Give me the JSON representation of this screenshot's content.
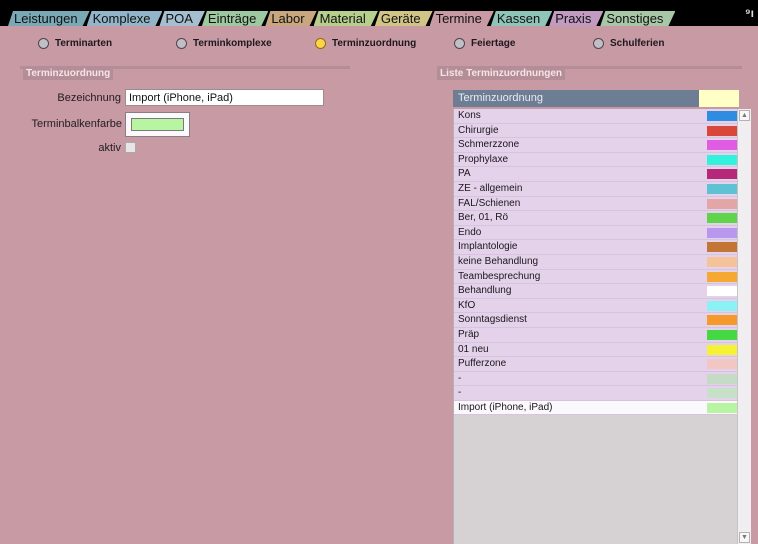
{
  "tabs": [
    {
      "label": "Leistungen",
      "color": "#79a9b5"
    },
    {
      "label": "Komplexe",
      "color": "#93b5c9"
    },
    {
      "label": "POA",
      "color": "#a6bfd0"
    },
    {
      "label": "Einträge",
      "color": "#9ec89f"
    },
    {
      "label": "Labor",
      "color": "#c9a77e"
    },
    {
      "label": "Material",
      "color": "#b7cf8c"
    },
    {
      "label": "Geräte",
      "color": "#d0c586"
    },
    {
      "label": "Termine",
      "color": "#c79aa4"
    },
    {
      "label": "Kassen",
      "color": "#8fc4b8"
    },
    {
      "label": "Praxis",
      "color": "#c29bc2"
    },
    {
      "label": "Sonstiges",
      "color": "#a8c7a6"
    }
  ],
  "radios": [
    {
      "label": "Terminarten",
      "active": false
    },
    {
      "label": "Terminkomplexe",
      "active": false
    },
    {
      "label": "Terminzuordnung",
      "active": true
    },
    {
      "label": "Feiertage",
      "active": false
    },
    {
      "label": "Schulferien",
      "active": false
    }
  ],
  "form": {
    "section_title": "Terminzuordnung",
    "bezeichnung_label": "Bezeichnung",
    "bezeichnung_value": "Import (iPhone, iPad)",
    "farbe_label": "Terminbalkenfarbe",
    "farbe_color": "#b7f5a3",
    "aktiv_label": "aktiv"
  },
  "list": {
    "section_title": "Liste Terminzuordnungen",
    "column_header": "Terminzuordnung",
    "header_swatch_color": "#ffffc6",
    "rows": [
      {
        "label": "Kons",
        "color": "#2e8de0"
      },
      {
        "label": "Chirurgie",
        "color": "#d9473a"
      },
      {
        "label": "Schmerzzone",
        "color": "#e05ce3"
      },
      {
        "label": "Prophylaxe",
        "color": "#33f2dd"
      },
      {
        "label": "PA",
        "color": "#b5287a"
      },
      {
        "label": "ZE - allgemein",
        "color": "#5ec1d4"
      },
      {
        "label": "FAL/Schienen",
        "color": "#e3a6a6"
      },
      {
        "label": "Ber, 01, Rö",
        "color": "#5fd44a"
      },
      {
        "label": "Endo",
        "color": "#b898ee"
      },
      {
        "label": "Implantologie",
        "color": "#c27534"
      },
      {
        "label": "keine Behandlung",
        "color": "#f5c29a"
      },
      {
        "label": "Teambesprechung",
        "color": "#f5a933"
      },
      {
        "label": "Behandlung",
        "color": "#ffffff"
      },
      {
        "label": "KfO",
        "color": "#8af2f5"
      },
      {
        "label": "Sonntagsdienst",
        "color": "#f59a2a"
      },
      {
        "label": "Präp",
        "color": "#44d944"
      },
      {
        "label": "01 neu",
        "color": "#f5f234"
      },
      {
        "label": "Pufferzone",
        "color": "#f2c6c2"
      },
      {
        "label": "-",
        "color": "#c6dbc5"
      },
      {
        "label": "-",
        "color": "#c7e0c8"
      },
      {
        "label": "Import (iPhone, iPad)",
        "color": "#b7f5a3",
        "selected": true
      }
    ]
  }
}
